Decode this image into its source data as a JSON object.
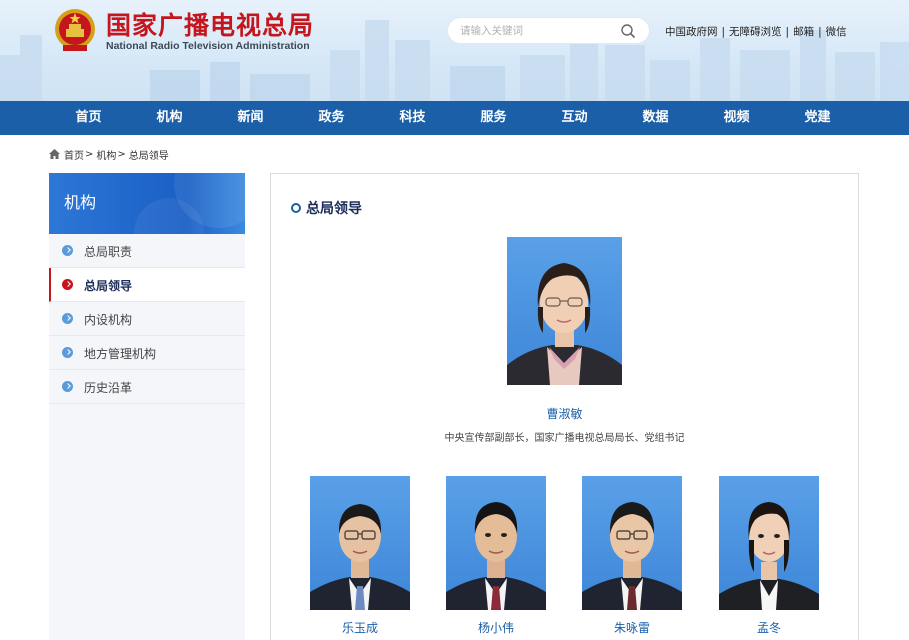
{
  "header": {
    "title": "国家广播电视总局",
    "subtitle": "National Radio Television Administration",
    "search_placeholder": "请输入关键词",
    "links": [
      "中国政府网",
      "无障碍浏览",
      "邮箱",
      "微信"
    ]
  },
  "nav": [
    "首页",
    "机构",
    "新闻",
    "政务",
    "科技",
    "服务",
    "互动",
    "数据",
    "视频",
    "党建"
  ],
  "breadcrumb": {
    "items": [
      "首页",
      "机构",
      "总局领导"
    ]
  },
  "sidebar": {
    "title": "机构",
    "items": [
      {
        "label": "总局职责",
        "active": false
      },
      {
        "label": "总局领导",
        "active": true
      },
      {
        "label": "内设机构",
        "active": false
      },
      {
        "label": "地方管理机构",
        "active": false
      },
      {
        "label": "历史沿革",
        "active": false
      }
    ]
  },
  "main": {
    "section_title": "总局领导",
    "leader": {
      "name": "曹淑敏",
      "title": "中央宣传部副部长，国家广播电视总局局长、党组书记"
    },
    "deputies": [
      {
        "name": "乐玉成"
      },
      {
        "name": "杨小伟"
      },
      {
        "name": "朱咏雷"
      },
      {
        "name": "孟冬"
      }
    ]
  },
  "colors": {
    "brand_red": "#c4161c",
    "nav_blue": "#1b5fa8",
    "photo_bg": "#4a93e0"
  }
}
